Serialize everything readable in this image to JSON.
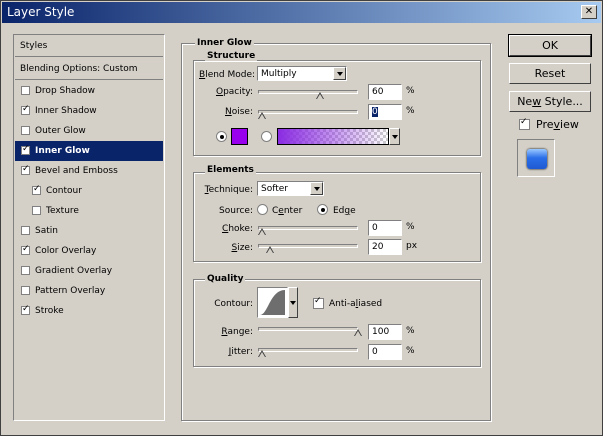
{
  "window": {
    "title": "Layer Style",
    "close_glyph": "✕"
  },
  "styles_list": {
    "header": "Styles",
    "blending": "Blending Options: Custom",
    "items": [
      {
        "label": "Drop Shadow",
        "checked": false
      },
      {
        "label": "Inner Shadow",
        "checked": true
      },
      {
        "label": "Outer Glow",
        "checked": false
      },
      {
        "label": "Inner Glow",
        "checked": true,
        "selected": true
      },
      {
        "label": "Bevel and Emboss",
        "checked": true
      },
      {
        "label": "Contour",
        "checked": true,
        "indent": true
      },
      {
        "label": "Texture",
        "checked": false,
        "indent": true
      },
      {
        "label": "Satin",
        "checked": false
      },
      {
        "label": "Color Overlay",
        "checked": true
      },
      {
        "label": "Gradient Overlay",
        "checked": false
      },
      {
        "label": "Pattern Overlay",
        "checked": false
      },
      {
        "label": "Stroke",
        "checked": true
      }
    ]
  },
  "main": {
    "title": "Inner Glow",
    "structure": {
      "title": "Structure",
      "blend_mode_label_u": "B",
      "blend_mode_label_rest": "lend Mode:",
      "blend_mode_value": "Multiply",
      "opacity_label_u": "O",
      "opacity_label_rest": "pacity:",
      "opacity_value": "60",
      "opacity_fraction": 0.6,
      "noise_label_u": "N",
      "noise_label_rest": "oise:",
      "noise_value": "0",
      "noise_fraction": 0,
      "unit_pct": "%",
      "color_swatch": "#9900ee",
      "gradient_start": "#8a2be2"
    },
    "elements": {
      "title": "Elements",
      "technique_label_u": "T",
      "technique_label_rest": "echnique:",
      "technique_value": "Softer",
      "source_label": "Source:",
      "source_center_u": "e",
      "source_center_pre": "C",
      "source_center_rest": "nter",
      "source_edge_u": "g",
      "source_edge_pre": "Ed",
      "source_edge_rest": "e",
      "choke_label_u": "C",
      "choke_label_rest": "hoke:",
      "choke_value": "0",
      "choke_fraction": 0,
      "size_label_u": "S",
      "size_label_rest": "ize:",
      "size_value": "20",
      "size_fraction": 0.08,
      "unit_pct": "%",
      "unit_px": "px"
    },
    "quality": {
      "title": "Quality",
      "contour_label": "Contour:",
      "anti_aliased_pre": "Anti-a",
      "anti_aliased_u": "l",
      "anti_aliased_rest": "iased",
      "anti_aliased_checked": true,
      "range_label_u": "R",
      "range_label_rest": "ange:",
      "range_value": "100",
      "range_fraction": 1,
      "jitter_label_u": "J",
      "jitter_label_rest": "itter:",
      "jitter_value": "0",
      "jitter_fraction": 0,
      "unit_pct": "%"
    }
  },
  "buttons": {
    "ok": "OK",
    "reset": "Reset",
    "new_style_pre": "Ne",
    "new_style_u": "w",
    "new_style_rest": " Style...",
    "preview_pre": "Pre",
    "preview_u": "v",
    "preview_rest": "iew",
    "preview_checked": true
  }
}
